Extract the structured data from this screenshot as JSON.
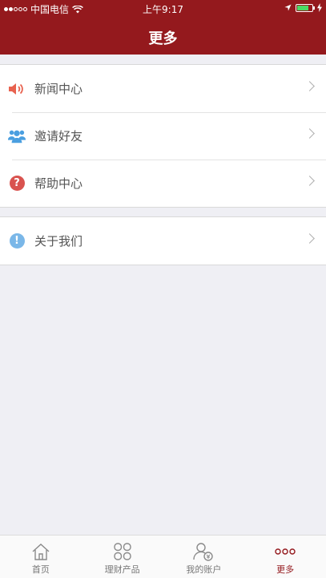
{
  "status_bar": {
    "carrier": "中国电信",
    "time": "上午9:17"
  },
  "header": {
    "title": "更多"
  },
  "menu_groups": [
    {
      "items": [
        {
          "label": "新闻中心",
          "icon": "speaker-icon"
        },
        {
          "label": "邀请好友",
          "icon": "users-icon"
        },
        {
          "label": "帮助中心",
          "icon": "help-icon",
          "glyph": "?"
        }
      ]
    },
    {
      "items": [
        {
          "label": "关于我们",
          "icon": "info-icon",
          "glyph": "!"
        }
      ]
    }
  ],
  "tabbar": {
    "active_color": "#94191d",
    "items": [
      {
        "label": "首页",
        "icon": "home-icon"
      },
      {
        "label": "理财产品",
        "icon": "products-icon"
      },
      {
        "label": "我的账户",
        "icon": "account-icon"
      },
      {
        "label": "更多",
        "icon": "more-icon",
        "active": true
      }
    ]
  },
  "colors": {
    "header_bg": "#94191d",
    "page_bg": "#efeff4",
    "speaker": "#e8624f",
    "users": "#4a9fe0",
    "help": "#d9534f",
    "info": "#7ab7e8"
  }
}
